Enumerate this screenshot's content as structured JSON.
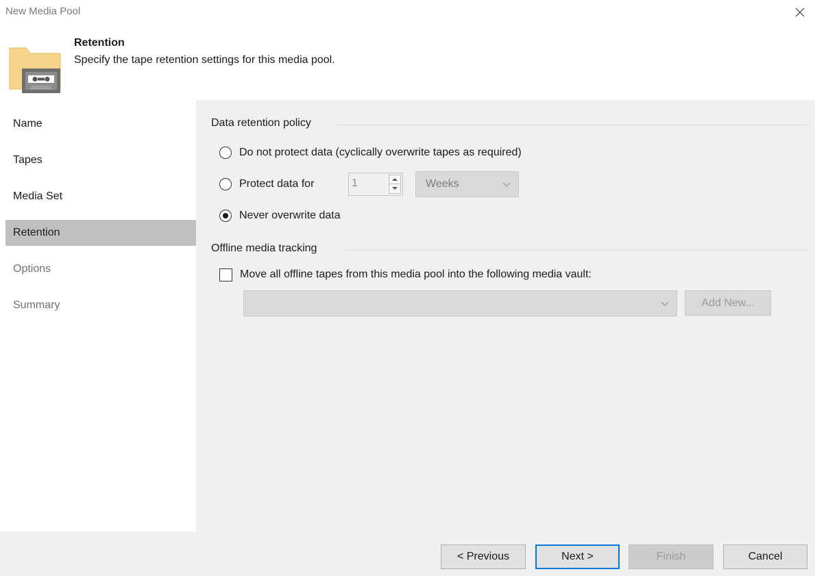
{
  "window": {
    "title": "New Media Pool"
  },
  "header": {
    "title": "Retention",
    "description": "Specify the tape retention settings for this media pool."
  },
  "sidebar": {
    "items": [
      {
        "label": "Name",
        "state": "normal"
      },
      {
        "label": "Tapes",
        "state": "normal"
      },
      {
        "label": "Media Set",
        "state": "normal"
      },
      {
        "label": "Retention",
        "state": "active"
      },
      {
        "label": "Options",
        "state": "disabled"
      },
      {
        "label": "Summary",
        "state": "disabled"
      }
    ]
  },
  "retention": {
    "section_title": "Data retention policy",
    "options": [
      {
        "label": "Do not protect data (cyclically overwrite tapes as required)",
        "checked": false
      },
      {
        "label": "Protect data for",
        "checked": false
      },
      {
        "label": "Never overwrite data",
        "checked": true
      }
    ],
    "period_value": "1",
    "period_unit": "Weeks"
  },
  "offline": {
    "section_title": "Offline media tracking",
    "checkbox_label": "Move all offline tapes from this media pool into the following media vault:",
    "checked": false,
    "vault_value": "",
    "add_new_label": "Add New..."
  },
  "footer": {
    "previous_label": "< Previous",
    "next_label": "Next >",
    "finish_label": "Finish",
    "cancel_label": "Cancel"
  },
  "colors": {
    "active_nav": "#c0c0c0",
    "content_bg": "#f0f0f0",
    "accent": "#0078d7",
    "folder": "#f5d58a"
  },
  "icons": {
    "close": "close-icon",
    "header": "tape-folder-icon",
    "dropdown": "chevron-down-icon"
  }
}
